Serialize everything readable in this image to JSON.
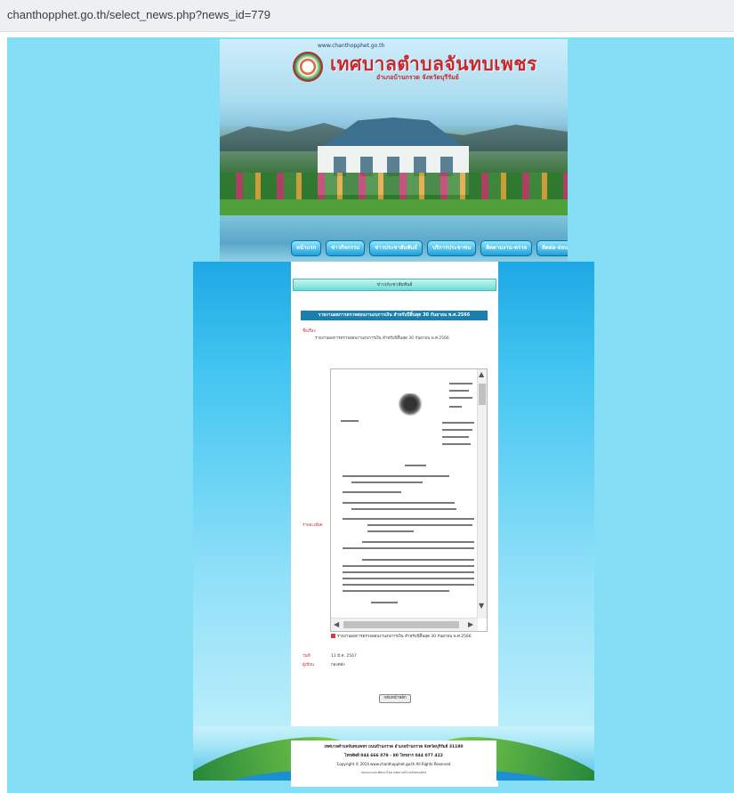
{
  "browser": {
    "url": "chanthopphet.go.th/select_news.php?news_id=779"
  },
  "header": {
    "site_url": "www.chanthopphet.go.th",
    "site_title": "เทศบาลตำบลจันทบเพชร",
    "site_subtitle": "อำเภอบ้านกรวด จังหวัดบุรีรัมย์",
    "nav": [
      "หน้าแรก",
      "ข่าวกิจกรรม",
      "ข่าวประชาสัมพันธ์",
      "บริการประชาชน",
      "ติดตามงาน-ตรวจ",
      "ติดต่อ-สอบถาม"
    ]
  },
  "main": {
    "section_title": "ข่าวประชาสัมพันธ์",
    "news_title": "รายงานผลการตรวจสอบงานงบการเงิน สำหรับปีสิ้นสุด 30 กันยายน พ.ศ.2566",
    "topic_label": "ชื่อเรื่อง",
    "topic_value": "รายงานผลการตรวจสอบงานงบการเงิน สำหรับปีสิ้นสุด 30 กันยายน พ.ศ.2566",
    "detail_label": "รายละเอียด",
    "attachment_text": "รายงานผลการตรวจสอบงานงบการเงิน สำหรับปีสิ้นสุด 30 กันยายน พ.ศ.2566",
    "date_label": "วันที่",
    "date_value": "13 มี.ค. 2567",
    "author_label": "ผู้เขียน",
    "author_value": "กองคลัง",
    "back_button": "กลับหน้าหลัก"
  },
  "footer": {
    "line1": "เทศบาลตำบลจันทบเพชร ถนนบ้านกรวด อำเภอบ้านกรวด จังหวัดบุรีรัมย์ 31180",
    "line2": "โทรศัพท์ 044 666 079 - 80 โทรสาร 044 077 422",
    "line3": "Copyright © 2014 www.chanthopphet.go.th All Rights Reserved",
    "line4": "ออกแบบและพัฒนาโดย เทศบาลตำบลจันทบเพชร"
  },
  "colors": {
    "page_bg": "#84def5",
    "title_red": "#c8282d",
    "title_bar": "#1a7fae"
  }
}
